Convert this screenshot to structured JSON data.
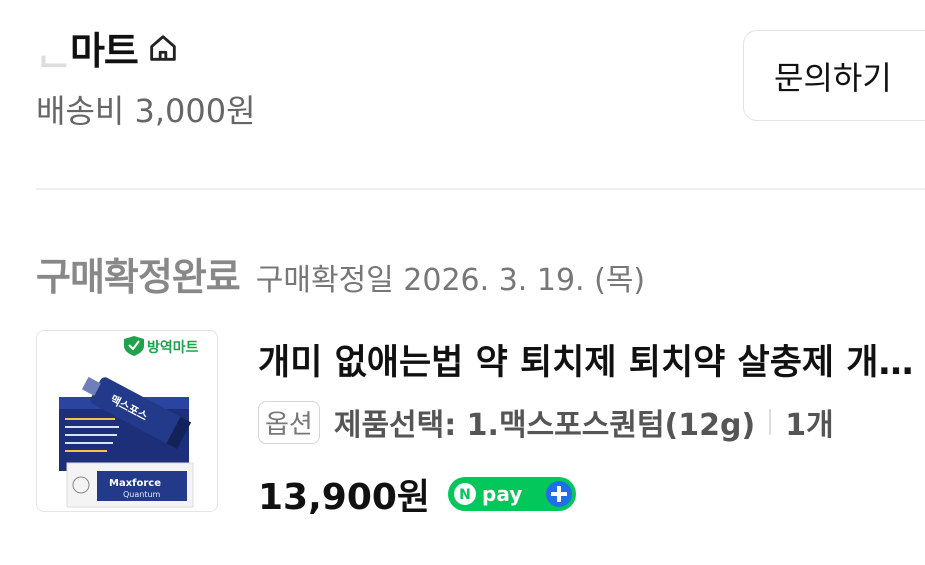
{
  "store": {
    "name": "′′′마트",
    "shipping": "배송비 3,000원"
  },
  "buttons": {
    "inquiry": "문의하기"
  },
  "order": {
    "status": "구매확정완료",
    "confirm_date": "구매확정일 2026. 3. 19. (목)"
  },
  "product": {
    "thumb_brand": "방역마트",
    "thumb_product": "Maxforce",
    "thumb_subtitle": "Quantum",
    "title": "개미 없애는법 약 퇴치제 퇴치약 살충제 개미약",
    "option_badge": "옵션",
    "option_text": "제품선택: 1.맥스포스퀀텀(12g)",
    "quantity": "1개",
    "price": "13,900원",
    "pay_badge": "pay"
  },
  "colors": {
    "npay_green": "#03c75a",
    "npay_blue": "#1e6fe8",
    "brand_green": "#21a14b",
    "tube_blue": "#233a8b"
  },
  "icons": [
    "home-icon",
    "npay-logo-icon",
    "plus-icon",
    "shield-icon"
  ]
}
